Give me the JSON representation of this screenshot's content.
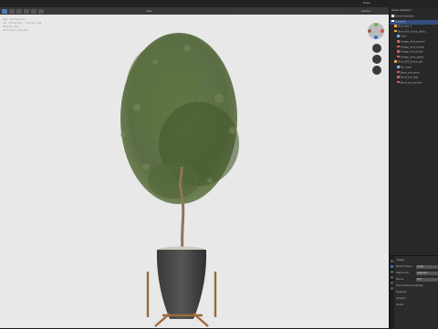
{
  "topbar": {
    "scene": "Scene"
  },
  "viewport": {
    "header_mode": "Object Mode",
    "header_view": "View",
    "overlay_lines": [
      "User Perspective",
      "(1) Collection | Olive_tree",
      "Objects 0/8",
      "Vertices 1,234,567"
    ],
    "options_label": "Options"
  },
  "outliner": {
    "header": "Scene Collection",
    "rows": [
      {
        "label": "Scene Collection",
        "color": "#ffffff",
        "selected": false
      },
      {
        "label": "Collection",
        "color": "#ffffff",
        "selected": true
      },
      {
        "label": "Olive_tree_1",
        "color": "#e8a24a",
        "selected": false
      },
      {
        "label": "Olive_003_Group_Olive...",
        "color": "#e8a24a",
        "selected": false
      },
      {
        "label": "Trunk",
        "color": "#7bb0e0",
        "selected": false
      },
      {
        "label": "Foliage_olive_branch",
        "color": "#d06060",
        "selected": false
      },
      {
        "label": "Foliage_olive_leaves",
        "color": "#d06060",
        "selected": false
      },
      {
        "label": "Foliage_olive_fruits",
        "color": "#d06060",
        "selected": false
      },
      {
        "label": "Foliage_olive_stems",
        "color": "#d06060",
        "selected": false
      },
      {
        "label": "Olive_003_Group_pot",
        "color": "#e8a24a",
        "selected": false
      },
      {
        "label": "Pot_mesh",
        "color": "#7bb0e0",
        "selected": false
      },
      {
        "label": "Stand_pot_wood",
        "color": "#d06060",
        "selected": false
      },
      {
        "label": "Stand_pot_legs",
        "color": "#d06060",
        "selected": false
      },
      {
        "label": "Stand_pot_ground",
        "color": "#d06060",
        "selected": false
      }
    ]
  },
  "properties": {
    "title": "Scene",
    "rows": [
      {
        "label": "Render Engine",
        "value": "Cycles"
      },
      {
        "label": "Feature Set",
        "value": "Supported"
      },
      {
        "label": "Device",
        "value": "CPU"
      },
      {
        "label": "Open Shading Language",
        "value": ""
      },
      {
        "label": "Sampling",
        "value": ""
      },
      {
        "label": "Viewport",
        "value": ""
      },
      {
        "label": "Render",
        "value": ""
      }
    ]
  },
  "colors": {
    "accent": "#4772b3",
    "selection": "#334d80",
    "viewport_bg": "#e8e8e8"
  }
}
